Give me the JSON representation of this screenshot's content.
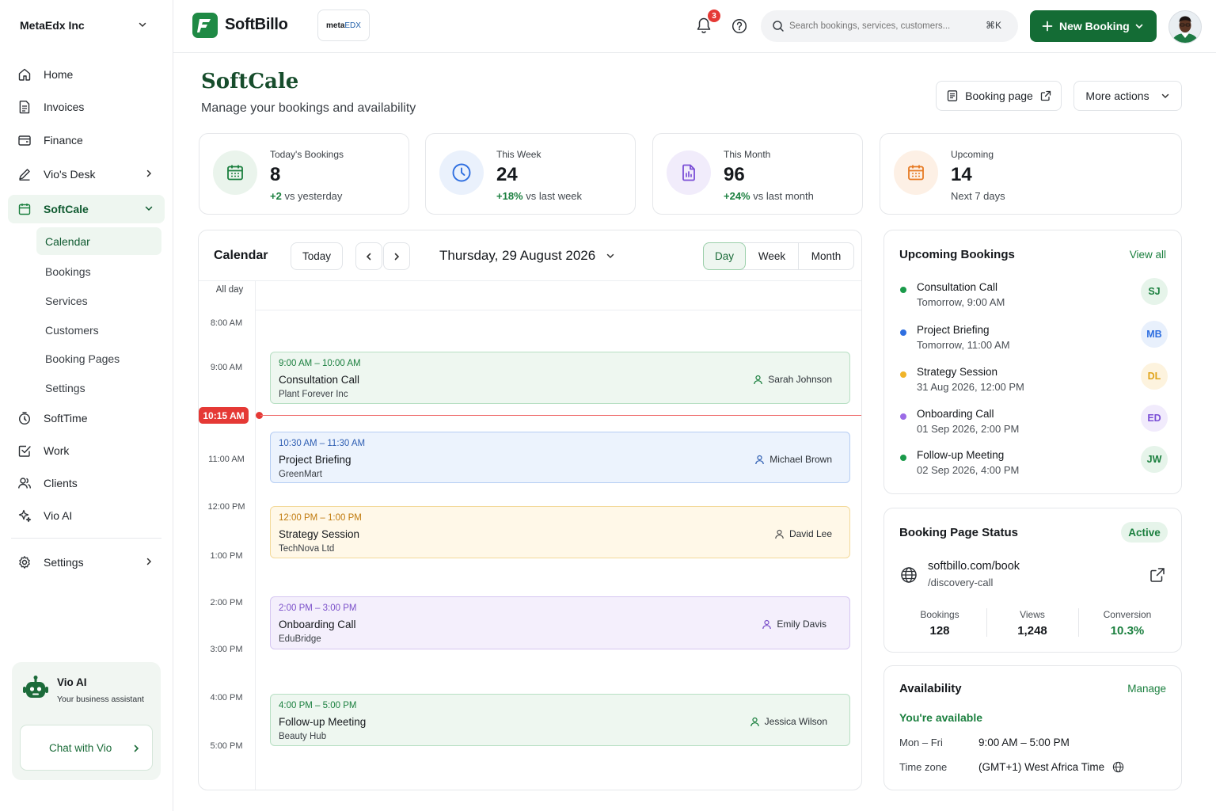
{
  "sidebar": {
    "org_name": "MetaEdx Inc",
    "nav": [
      {
        "label": "Home"
      },
      {
        "label": "Invoices"
      },
      {
        "label": "Finance"
      },
      {
        "label": "Vio's Desk"
      },
      {
        "label": "SoftCale"
      }
    ],
    "softcale_sub": [
      "Calendar",
      "Bookings",
      "Services",
      "Customers",
      "Booking Pages",
      "Settings"
    ],
    "nav2": [
      {
        "label": "SoftTime"
      },
      {
        "label": "Work"
      },
      {
        "label": "Clients"
      },
      {
        "label": "Vio AI"
      }
    ],
    "settings_label": "Settings",
    "vio": {
      "title": "Vio AI",
      "subtitle": "Your business assistant",
      "cta": "Chat with Vio"
    }
  },
  "topbar": {
    "brand": "SoftBillo",
    "workspace_badge_bold": "meta",
    "workspace_badge_rest": "EDX",
    "notification_count": "3",
    "search_placeholder": "Search bookings, services, customers...",
    "search_shortcut": "⌘K",
    "new_booking": "New Booking"
  },
  "page": {
    "title": "SoftCale",
    "subtitle": "Manage your bookings and availability",
    "booking_page_btn": "Booking page",
    "more_actions_btn": "More actions"
  },
  "stats": [
    {
      "label": "Today's Bookings",
      "value": "8",
      "delta": "+2",
      "suffix": " vs yesterday",
      "icon": "calendar-icon",
      "color": "#1a7f3e"
    },
    {
      "label": "This Week",
      "value": "24",
      "delta": "+18%",
      "suffix": " vs last week",
      "icon": "clock-icon",
      "color": "#2f6fe0"
    },
    {
      "label": "This Month",
      "value": "96",
      "delta": "+24%",
      "suffix": " vs last month",
      "icon": "document-icon",
      "color": "#7b4fd6"
    },
    {
      "label": "Upcoming",
      "value": "14",
      "delta": "",
      "suffix": "Next 7 days",
      "icon": "calendar-icon",
      "color": "#e67a24"
    }
  ],
  "calendar": {
    "title": "Calendar",
    "today_btn": "Today",
    "date": "Thursday, 29 August 2026",
    "views": [
      "Day",
      "Week",
      "Month"
    ],
    "active_view": "Day",
    "all_day": "All day",
    "hours": [
      "8:00 AM",
      "9:00 AM",
      "11:00 AM",
      "12:00 PM",
      "1:00 PM",
      "2:00 PM",
      "3:00 PM",
      "4:00 PM",
      "5:00 PM"
    ],
    "now": "10:15 AM",
    "events": [
      {
        "time": "9:00 AM – 10:00 AM",
        "name": "Consultation Call",
        "company": "Plant Forever Inc",
        "person": "Sarah Johnson",
        "color": "green"
      },
      {
        "time": "10:30 AM – 11:30 AM",
        "name": "Project Briefing",
        "company": "GreenMart",
        "person": "Michael Brown",
        "color": "blue"
      },
      {
        "time": "12:00 PM – 1:00 PM",
        "name": "Strategy Session",
        "company": "TechNova Ltd",
        "person": "David Lee",
        "color": "yellow"
      },
      {
        "time": "2:00 PM – 3:00 PM",
        "name": "Onboarding Call",
        "company": "EduBridge",
        "person": "Emily Davis",
        "color": "purple"
      },
      {
        "time": "4:00 PM – 5:00 PM",
        "name": "Follow-up Meeting",
        "company": "Beauty Hub",
        "person": "Jessica Wilson",
        "color": "green"
      }
    ]
  },
  "upcoming": {
    "title": "Upcoming Bookings",
    "view_all": "View all",
    "items": [
      {
        "name": "Consultation Call",
        "when": "Tomorrow, 9:00 AM",
        "initials": "SJ",
        "color": "#1a9a4a"
      },
      {
        "name": "Project Briefing",
        "when": "Tomorrow, 11:00 AM",
        "initials": "MB",
        "color": "#2f6fe0"
      },
      {
        "name": "Strategy Session",
        "when": "31 Aug 2026, 12:00 PM",
        "initials": "DL",
        "color": "#f0b429"
      },
      {
        "name": "Onboarding Call",
        "when": "01 Sep 2026, 2:00 PM",
        "initials": "ED",
        "color": "#9b6be6"
      },
      {
        "name": "Follow-up Meeting",
        "when": "02 Sep 2026, 4:00 PM",
        "initials": "JW",
        "color": "#1a9a4a"
      }
    ]
  },
  "booking_status": {
    "title": "Booking Page Status",
    "badge": "Active",
    "url_main": "softbillo.com/book",
    "url_path": "/discovery-call",
    "metrics": [
      {
        "label": "Bookings",
        "value": "128"
      },
      {
        "label": "Views",
        "value": "1,248"
      },
      {
        "label": "Conversion",
        "value": "10.3%"
      }
    ]
  },
  "availability": {
    "title": "Availability",
    "manage": "Manage",
    "status": "You're available",
    "days_label": "Mon – Fri",
    "hours": "9:00 AM – 5:00 PM",
    "tz_label": "Time zone",
    "tz_value": "(GMT+1) West Africa Time"
  }
}
